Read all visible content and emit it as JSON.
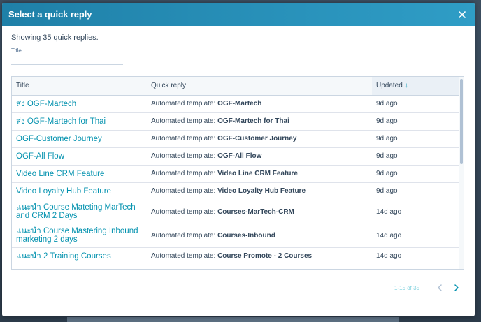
{
  "modal": {
    "title": "Select a quick reply",
    "count_text": "Showing 35 quick replies.",
    "search_label": "Title",
    "search_value": ""
  },
  "table": {
    "columns": {
      "title": "Title",
      "reply": "Quick reply",
      "updated": "Updated"
    },
    "sort": "descending",
    "rows": [
      {
        "title": "ส่ง OGF-Martech",
        "prefix": "Automated template:",
        "template": "OGF-Martech",
        "updated": "9d ago"
      },
      {
        "title": "ส่ง OGF-Martech for Thai",
        "prefix": "Automated template:",
        "template": "OGF-Martech for Thai",
        "updated": "9d ago"
      },
      {
        "title": "OGF-Customer Journey",
        "prefix": "Automated template:",
        "template": "OGF-Customer Journey",
        "updated": "9d ago"
      },
      {
        "title": "OGF-All Flow",
        "prefix": "Automated template:",
        "template": "OGF-All  Flow",
        "updated": "9d ago"
      },
      {
        "title": "Video Line CRM Feature",
        "prefix": "Automated template:",
        "template": "Video Line CRM   Feature",
        "updated": "9d ago"
      },
      {
        "title": "Video Loyalty Hub Feature",
        "prefix": "Automated template:",
        "template": "Video Loyalty Hub Feature",
        "updated": "9d ago"
      },
      {
        "title": "แนะนำ Course Mateting MarTech and CRM 2 Days",
        "prefix": "Automated template:",
        "template": "Courses-MarTech-CRM",
        "updated": "14d ago"
      },
      {
        "title": "แนะนำ Course Mastering Inbound marketing 2 days",
        "prefix": "Automated template:",
        "template": "Courses-Inbound",
        "updated": "14d ago"
      },
      {
        "title": "แนะนำ 2 Training Courses",
        "prefix": "Automated template:",
        "template": "Course Promote  - 2 Courses",
        "updated": "14d ago"
      }
    ]
  },
  "pagination": {
    "info": "1-15 of 35"
  },
  "colors": {
    "header_start": "#1f80a8",
    "header_end": "#2f9dc6",
    "link": "#0091ae",
    "text": "#33475b"
  }
}
